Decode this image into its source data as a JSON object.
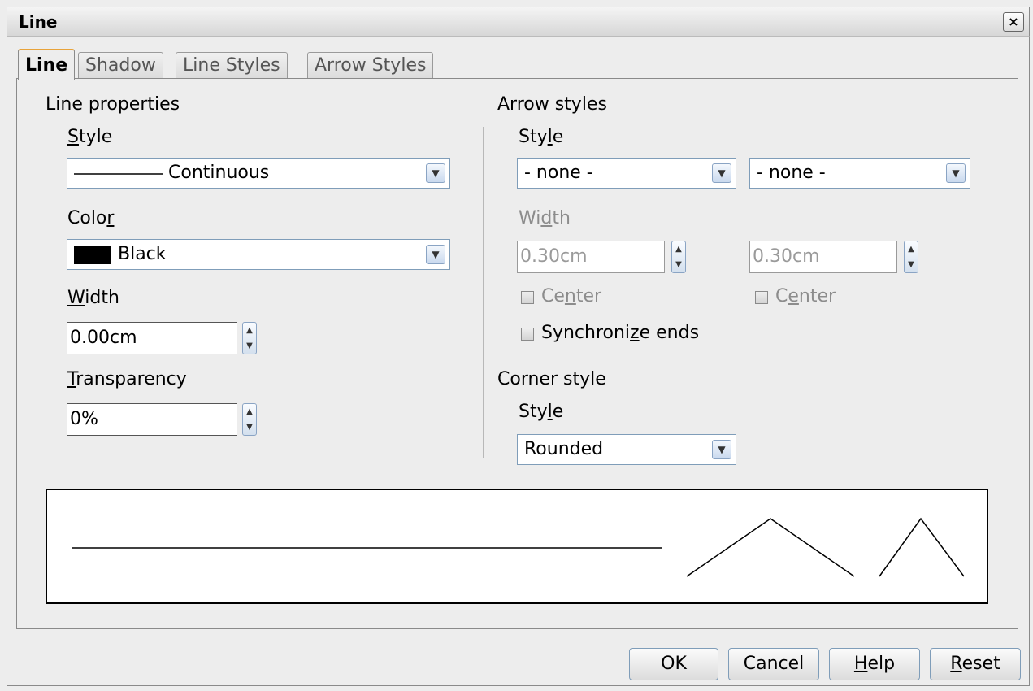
{
  "window": {
    "title": "Line",
    "close_glyph": "×"
  },
  "tabs": [
    {
      "label": "Line",
      "active": true
    },
    {
      "label": "Shadow",
      "active": false
    },
    {
      "label": "Line Styles",
      "active": false
    },
    {
      "label": "Arrow Styles",
      "active": false
    }
  ],
  "line_properties": {
    "group_label": "Line properties",
    "style_label_pre": "",
    "style_label_u": "S",
    "style_label_post": "tyle",
    "style_value": "Continuous",
    "color_label_pre": "Colo",
    "color_label_u": "r",
    "color_label_post": "",
    "color_value": "Black",
    "color_swatch": "#000000",
    "width_label_pre": "",
    "width_label_u": "W",
    "width_label_post": "idth",
    "width_value": "0.00cm",
    "transparency_label_pre": "",
    "transparency_label_u": "T",
    "transparency_label_post": "ransparency",
    "transparency_value": "0%"
  },
  "arrow_styles": {
    "group_label": "Arrow styles",
    "style_label_pre": "Sty",
    "style_label_u": "l",
    "style_label_post": "e",
    "start_style": "- none -",
    "end_style": "- none -",
    "width_label_pre": "Wi",
    "width_label_u": "d",
    "width_label_post": "th",
    "start_width": "0.30cm",
    "end_width": "0.30cm",
    "center_label_pre": "Ce",
    "center_label_u": "n",
    "center_label_post": "ter",
    "center2_label_pre": "C",
    "center2_label_u": "e",
    "center2_label_post": "nter",
    "sync_label_pre": "Synchroni",
    "sync_label_u": "z",
    "sync_label_post": "e ends"
  },
  "corner_style": {
    "group_label": "Corner style",
    "style_label_pre": "Sty",
    "style_label_u": "l",
    "style_label_post": "e",
    "style_value": "Rounded"
  },
  "buttons": {
    "ok": "OK",
    "cancel": "Cancel",
    "help_u": "H",
    "help_post": "elp",
    "reset_u": "R",
    "reset_post": "eset"
  },
  "icons": {
    "dropdown": "chevron-down-icon",
    "spin": "spin-arrows-icon",
    "close": "close-icon"
  }
}
